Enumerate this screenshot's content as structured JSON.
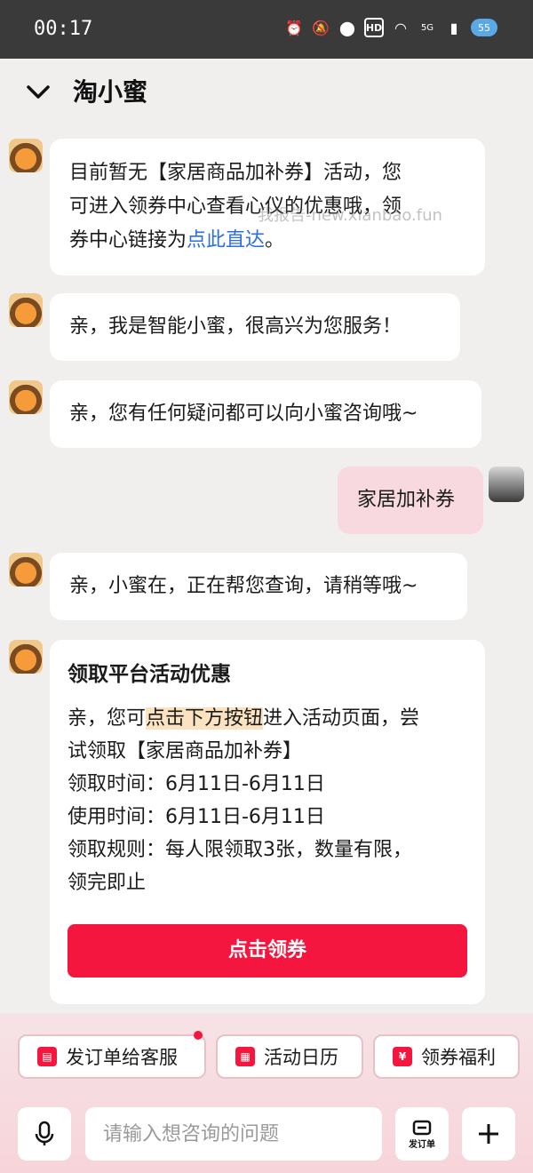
{
  "status_bar": {
    "time": "00:17",
    "hd": "HD",
    "network": "5G",
    "battery": "55"
  },
  "header": {
    "title": "淘小蜜"
  },
  "messages": {
    "m1_line1": "目前暂无【家居商品加补券】活动，您",
    "m1_line2": "可进入领券中心查看心仪的优惠哦，领",
    "m1_line3_prefix": "券中心链接为",
    "m1_link": "点此直达",
    "m1_suffix": "。",
    "m2": "亲，我是智能小蜜，很高兴为您服务！",
    "m3": "亲，您有任何疑问都可以向小蜜咨询哦~",
    "user_msg": "家居加补券",
    "m4": "亲，小蜜在，正在帮您查询，请稍等哦~"
  },
  "watermark": "我报告-new.xianbao.fun",
  "card": {
    "title": "领取平台活动优惠",
    "line1_a": "亲，您可",
    "line1_hl": "点击下方按钮",
    "line1_b": "进入活动页面，尝",
    "line2": "试领取【家居商品加补券】",
    "line3": "领取时间：6月11日-6月11日",
    "line4": "使用时间：6月11日-6月11日",
    "line5": "领取规则：每人限领取3张，数量有限，",
    "line6": "领完即止",
    "button": "点击领券"
  },
  "quick_actions": [
    {
      "label": "发订单给客服",
      "icon": "order-icon"
    },
    {
      "label": "活动日历",
      "icon": "calendar-icon"
    },
    {
      "label": "领券福利",
      "icon": "coupon-icon"
    }
  ],
  "input": {
    "placeholder": "请输入想咨询的问题"
  },
  "order_button_label": "发订单",
  "colors": {
    "accent": "#f4163e",
    "link": "#2b6fe0",
    "user_bubble": "#f7d9df"
  }
}
